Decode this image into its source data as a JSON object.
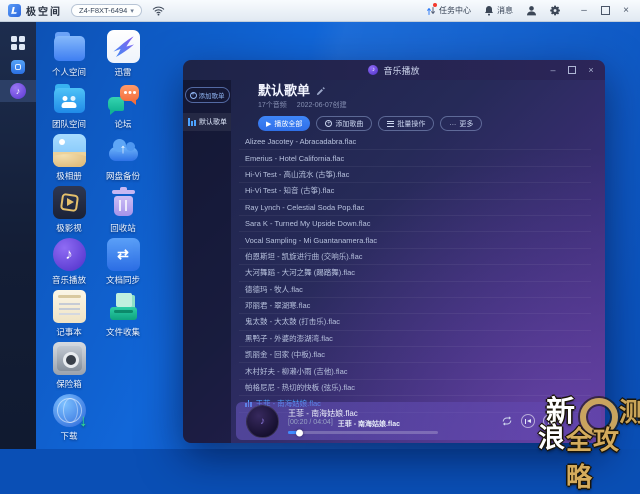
{
  "glyphs": {
    "chevron_down": "▾",
    "minimize": "–",
    "close": "×",
    "play": "▶",
    "more_ellipsis": "…",
    "plus": "+",
    "music_note": "♪",
    "up_arrow": "↑",
    "down_arrow": "↓",
    "sync_arrows": "⇄"
  },
  "system_bar": {
    "app_name": "极空间",
    "device_id": "Z4-F8XT-6494",
    "task_center_label": "任务中心",
    "messages_label": "消息"
  },
  "desktop": {
    "left_column": [
      {
        "label": "个人空间",
        "icon": "folder-personal"
      },
      {
        "label": "团队空间",
        "icon": "folder-team"
      },
      {
        "label": "极相册",
        "icon": "photos"
      },
      {
        "label": "极影视",
        "icon": "video"
      },
      {
        "label": "音乐播放",
        "icon": "music"
      },
      {
        "label": "记事本",
        "icon": "notepad"
      },
      {
        "label": "保险箱",
        "icon": "safe"
      },
      {
        "label": "下载",
        "icon": "download"
      }
    ],
    "right_column": [
      {
        "label": "迅雷",
        "icon": "xunlei"
      },
      {
        "label": "论坛",
        "icon": "forum"
      },
      {
        "label": "网盘备份",
        "icon": "cloud-backup"
      },
      {
        "label": "回收站",
        "icon": "trash"
      },
      {
        "label": "文档同步",
        "icon": "doc-sync"
      },
      {
        "label": "文件收集",
        "icon": "file-collect"
      }
    ]
  },
  "window": {
    "title": "音乐播放",
    "sidebar": {
      "add_playlist_label": "添加歌单",
      "playlists": [
        {
          "label": "默认歌单",
          "active": true
        }
      ]
    },
    "header": {
      "title": "默认歌单",
      "meta_count": "17个音频",
      "meta_created": "2022-06-07创建",
      "play_all_label": "播放全部",
      "add_songs_label": "添加歌曲",
      "batch_label": "批量操作",
      "more_label": "更多"
    },
    "songs": [
      {
        "title": "Alizee Jacotey - Abracadabra.flac",
        "playing": false
      },
      {
        "title": "Emerius - Hotel California.flac",
        "playing": false
      },
      {
        "title": "Hi-Vi Test - 高山流水 (古筝).flac",
        "playing": false
      },
      {
        "title": "Hi-Vi Test - 知音 (古筝).flac",
        "playing": false
      },
      {
        "title": "Ray Lynch - Celestial Soda Pop.flac",
        "playing": false
      },
      {
        "title": "Sara K - Turned My Upside Down.flac",
        "playing": false
      },
      {
        "title": "Vocal Sampling - Mi Guantanamera.flac",
        "playing": false
      },
      {
        "title": "伯恩斯坦 - 凯旋进行曲 (交响乐).flac",
        "playing": false
      },
      {
        "title": "大河舞蹈 - 大河之舞 (踢踏舞).flac",
        "playing": false
      },
      {
        "title": "德德玛 - 牧人.flac",
        "playing": false
      },
      {
        "title": "邓丽君 - 翠湖寒.flac",
        "playing": false
      },
      {
        "title": "鬼太鼓 - 大太鼓 (打击乐).flac",
        "playing": false
      },
      {
        "title": "黑鸭子 - 外婆的澎湖湾.flac",
        "playing": false
      },
      {
        "title": "凯丽金 - 回家 (中板).flac",
        "playing": false
      },
      {
        "title": "木村好夫 - 柳濑小雨 (吉他).flac",
        "playing": false
      },
      {
        "title": "帕格尼尼 - 热切的快板 (弦乐).flac",
        "playing": false
      },
      {
        "title": "王菲 - 南海姑娘.flac",
        "playing": true
      }
    ],
    "player": {
      "track_title": "王菲 - 南海姑娘.flac",
      "time": "[00:20 / 04:04]",
      "now_playing": "王菲 - 南海姑娘.flac",
      "progress_percent": 8
    }
  },
  "watermark": {
    "char_top": "新",
    "char_bottom": "浪",
    "brand": "全攻略",
    "edge_char": "测"
  }
}
